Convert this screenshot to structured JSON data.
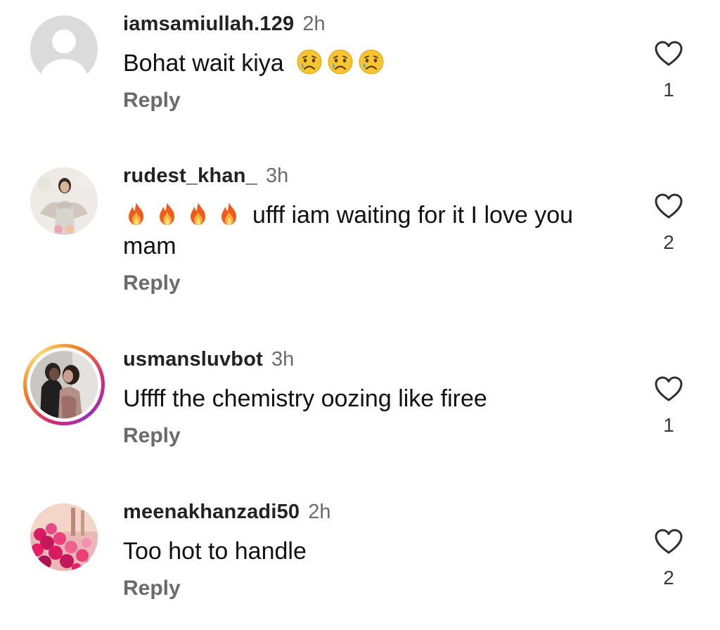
{
  "comments": [
    {
      "username": "iamsamiullah.129",
      "time": "2h",
      "text": "Bohat wait kiya",
      "emojis": [
        "crying-face",
        "crying-face",
        "crying-face"
      ],
      "reply_label": "Reply",
      "likes": "1"
    },
    {
      "username": "rudest_khan_",
      "time": "3h",
      "text": "ufff iam waiting for it I love you mam",
      "emojis": [
        "fire",
        "fire",
        "fire",
        "fire"
      ],
      "reply_label": "Reply",
      "likes": "2"
    },
    {
      "username": "usmansluvbot",
      "time": "3h",
      "text": "Uffff the chemistry oozing like firee",
      "reply_label": "Reply",
      "likes": "1",
      "has_story_ring": true
    },
    {
      "username": "meenakhanzadi50",
      "time": "2h",
      "text": "Too hot to handle",
      "reply_label": "Reply",
      "likes": "2"
    }
  ],
  "colors": {
    "username": "#222222",
    "secondary": "#6b6b6b",
    "story_ring": [
      "#d62976",
      "#fa7e1e",
      "#feda75"
    ]
  }
}
